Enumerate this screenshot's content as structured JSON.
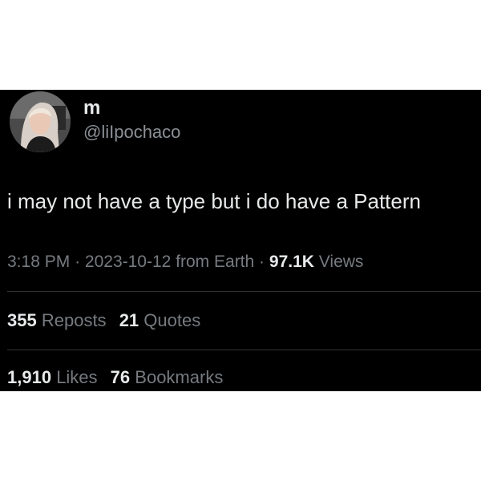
{
  "user": {
    "display_name": "m",
    "handle": "@liIpochaco"
  },
  "tweet": {
    "text": "i may not have a type but i do have a Pattern",
    "time": "3:18 PM",
    "date": "2023-10-12",
    "source": "from Earth",
    "separator": "·",
    "views_count": "97.1K",
    "views_label": "Views"
  },
  "stats": {
    "reposts_count": "355",
    "reposts_label": "Reposts",
    "quotes_count": "21",
    "quotes_label": "Quotes",
    "likes_count": "1,910",
    "likes_label": "Likes",
    "bookmarks_count": "76",
    "bookmarks_label": "Bookmarks"
  },
  "colors": {
    "background": "#000000",
    "primary_text": "#e7e9ea",
    "secondary_text": "#767b80",
    "divider": "#2f3336"
  },
  "icons": {
    "avatar": "profile-photo"
  }
}
